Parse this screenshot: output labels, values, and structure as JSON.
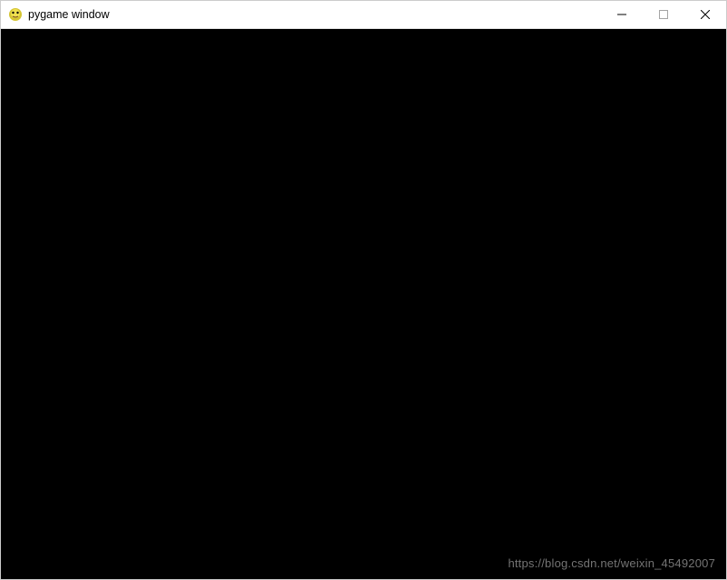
{
  "window": {
    "title": "pygame window",
    "icon_name": "pygame-snake-icon"
  },
  "content": {
    "background_color": "#000000"
  },
  "watermark": {
    "text": "https://blog.csdn.net/weixin_45492007"
  }
}
